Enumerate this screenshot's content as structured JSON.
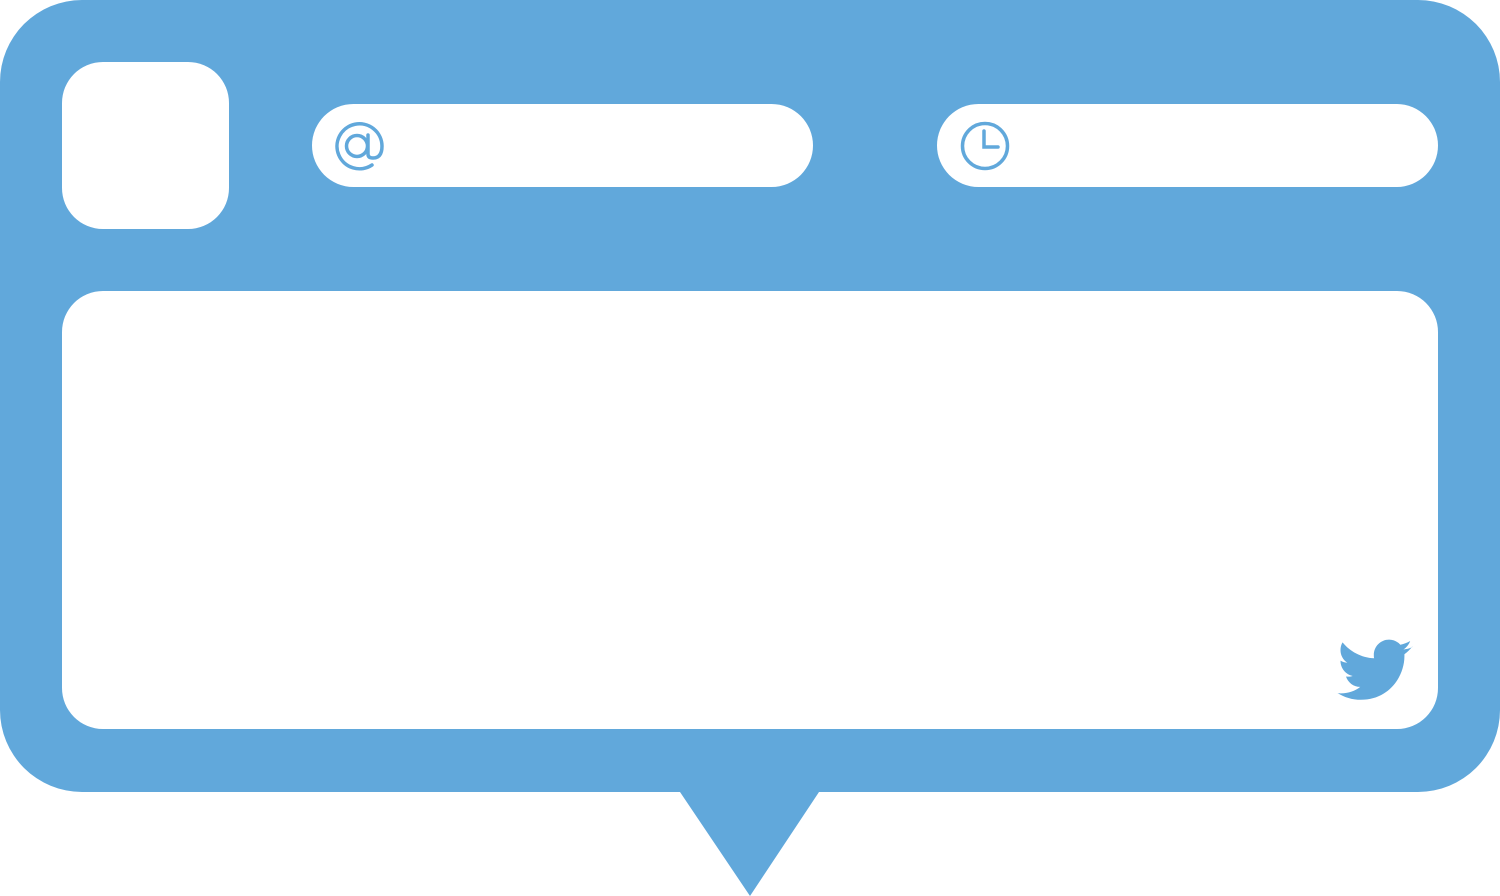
{
  "colors": {
    "frame": "#61A8DB",
    "panel": "#FFFFFF",
    "icon": "#61A8DB"
  },
  "icons": {
    "handle": "at-sign-icon",
    "time": "clock-icon",
    "brand": "twitter-bird-icon"
  },
  "fields": {
    "avatar": "",
    "handle": "",
    "time": "",
    "tweet_body": ""
  }
}
